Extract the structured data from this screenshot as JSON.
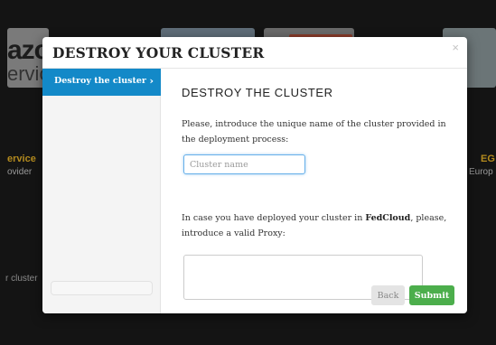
{
  "background": {
    "logo_text": "azc",
    "logo_sub": "ervic",
    "left_card_title": "ervice",
    "left_card_sub": "ovider",
    "right_card_title": "EG",
    "right_card_sub": "Europ",
    "bottom_left_text": "r cluster"
  },
  "modal": {
    "title": "DESTROY YOUR CLUSTER",
    "close_label": "×"
  },
  "sidebar": {
    "items": [
      {
        "label": "Destroy the cluster",
        "icon": "chevron-right-icon",
        "chevron": "›"
      }
    ]
  },
  "content": {
    "section_title": "DESTROY THE CLUSTER",
    "intro_text": "Please, introduce the unique name of the cluster provided in the deployment process:",
    "cluster_name_value": "",
    "cluster_name_placeholder": "Cluster name",
    "proxy_text_before": "In case you have deployed your cluster in ",
    "proxy_text_bold": "FedCloud",
    "proxy_text_after": ", please, introduce a valid Proxy:",
    "proxy_value": ""
  },
  "buttons": {
    "back_label": "Back",
    "submit_label": "Submit"
  },
  "colors": {
    "sidebar_active": "#1389c8",
    "submit": "#4cae4c",
    "back": "#e4e4e4",
    "input_focus": "#66afe9"
  }
}
